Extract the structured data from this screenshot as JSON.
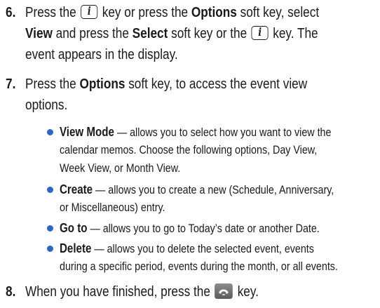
{
  "steps": [
    {
      "number": "6.",
      "lines": [
        [
          "Press the ",
          "{KEY}",
          " key or press the ",
          "<b>Options</b>",
          " soft key, select"
        ],
        [
          "<b>View</b>",
          " and press the ",
          "<b>Select</b>",
          " soft key or the ",
          "{KEY}",
          " key. The"
        ],
        [
          "event appears in the display."
        ]
      ]
    },
    {
      "number": "7.",
      "lines": [
        [
          "Press the ",
          "<b>Options</b>",
          " soft key, to access the event view"
        ],
        [
          "options."
        ]
      ]
    },
    {
      "number": "8.",
      "lines": [
        [
          "When you have finished, press the ",
          "{ENDKEY}",
          " key."
        ]
      ]
    }
  ],
  "bullets": [
    {
      "term": "View Mode",
      "lines": [
        " — allows you to select how you want to view the",
        "calendar memos. Choose the following options, Day View,",
        "Week View, or Month View."
      ]
    },
    {
      "term": "Create",
      "lines": [
        " — allows you to create a new (Schedule, Anniversary,",
        "or Miscellaneous) entry."
      ]
    },
    {
      "term": "Go to",
      "lines": [
        " — allows you to go to Today’s date or another Date."
      ]
    },
    {
      "term": "Delete",
      "lines": [
        " — allows you to delete the selected event, events",
        "during a specific period, events during the month, or all events."
      ]
    }
  ],
  "icons": {
    "info_key": "i-key-icon",
    "end_key": "end-call-key-icon",
    "bullet_color": "#2a66c8"
  }
}
